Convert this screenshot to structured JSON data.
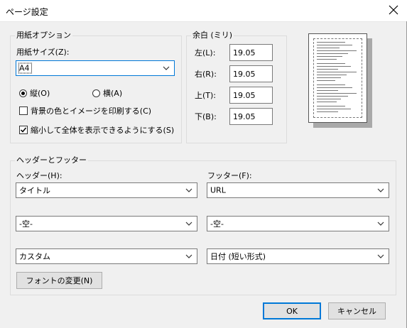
{
  "window": {
    "title": "ページ設定"
  },
  "paper_group": {
    "title": "用紙オプション",
    "size_label": "用紙サイズ(Z):",
    "size_value": "A4",
    "orientation_portrait": "縦(O)",
    "orientation_landscape": "横(A)",
    "orientation_selected": "portrait",
    "print_background": "背景の色とイメージを印刷する(C)",
    "print_background_checked": false,
    "shrink_to_fit": "縮小して全体を表示できるようにする(S)",
    "shrink_to_fit_checked": true
  },
  "margins_group": {
    "title": "余白 (ミリ)",
    "left_label": "左(L):",
    "left_value": "19.05",
    "right_label": "右(R):",
    "right_value": "19.05",
    "top_label": "上(T):",
    "top_value": "19.05",
    "bottom_label": "下(B):",
    "bottom_value": "19.05"
  },
  "header_footer_group": {
    "title": "ヘッダーとフッター",
    "header_label": "ヘッダー(H):",
    "footer_label": "フッター(F):",
    "header_values": [
      "タイトル",
      "-空-",
      "カスタム"
    ],
    "footer_values": [
      "URL",
      "-空-",
      "日付 (短い形式)"
    ],
    "font_button": "フォントの変更(N)"
  },
  "buttons": {
    "ok": "OK",
    "cancel": "キャンセル"
  },
  "colors": {
    "dialog_bg": "#f0f0f0",
    "accent": "#0078d7",
    "button_bg": "#e1e1e1"
  }
}
